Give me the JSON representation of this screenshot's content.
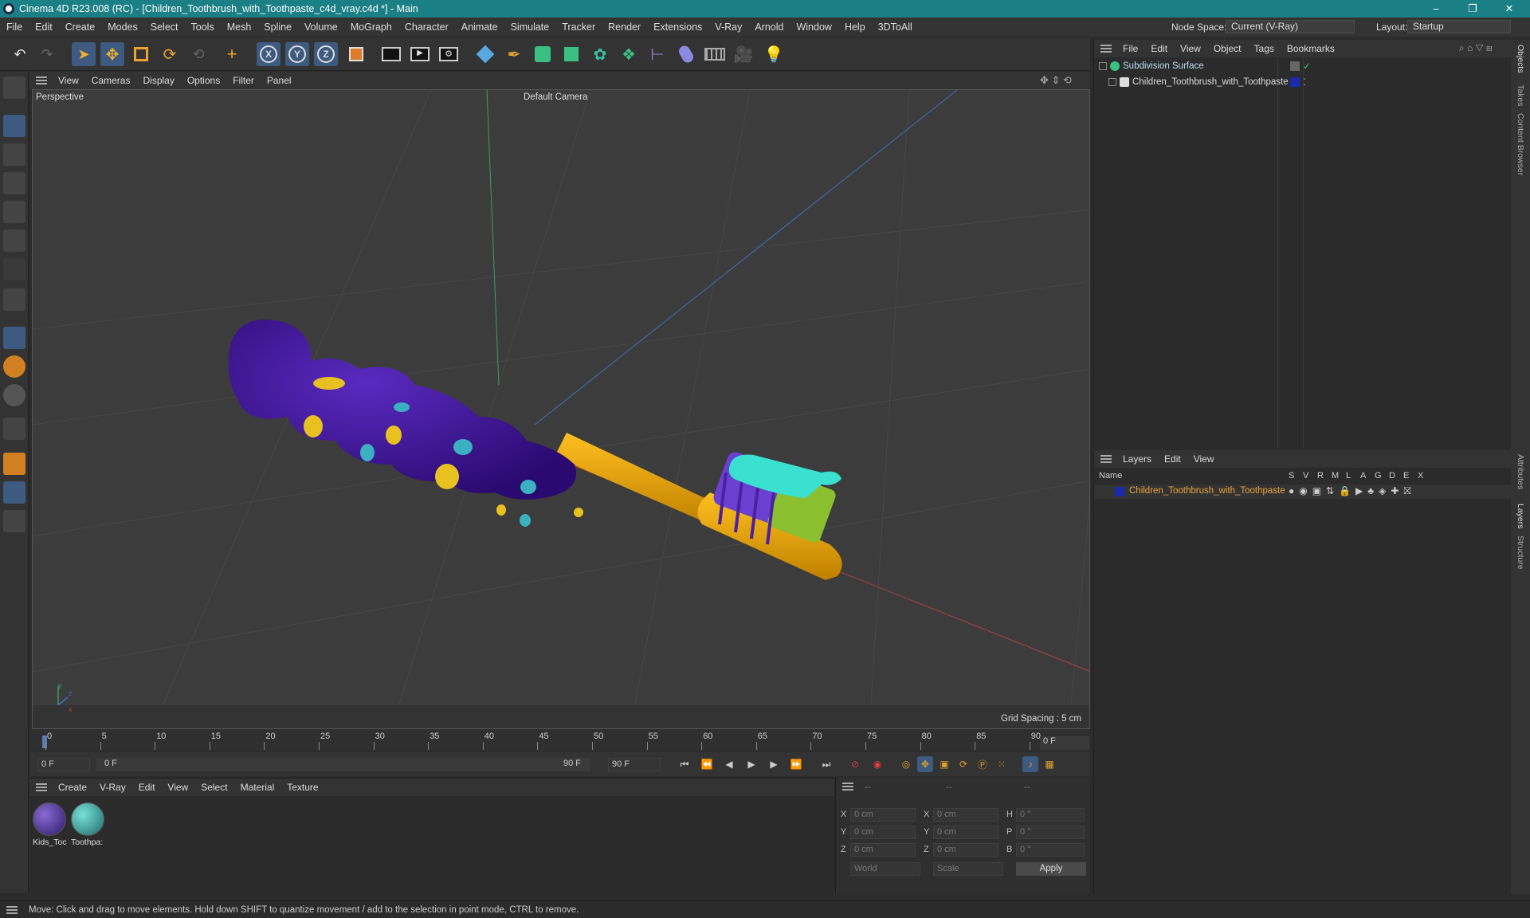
{
  "window": {
    "title": "Cinema 4D R23.008 (RC) - [Children_Toothbrush_with_Toothpaste_c4d_vray.c4d *] - Main",
    "minimize": "–",
    "restore": "❐",
    "close": "✕"
  },
  "menu": [
    "File",
    "Edit",
    "Create",
    "Modes",
    "Select",
    "Tools",
    "Mesh",
    "Spline",
    "Volume",
    "MoGraph",
    "Character",
    "Animate",
    "Simulate",
    "Tracker",
    "Render",
    "Extensions",
    "V-Ray",
    "Arnold",
    "Window",
    "Help",
    "3DToAll"
  ],
  "node_space": {
    "label": "Node Space:",
    "value": "Current (V-Ray)"
  },
  "layout": {
    "label": "Layout:",
    "value": "Startup"
  },
  "toolbar_icons": [
    "undo-icon",
    "redo-icon",
    "select-icon",
    "move-icon",
    "scale-icon",
    "rotate-icon",
    "recent-icon",
    "add-icon",
    "x-axis-icon",
    "y-axis-icon",
    "z-axis-icon",
    "coordinate-system-icon",
    "render-view-icon",
    "render-picture-viewer-icon",
    "render-settings-icon",
    "cube-icon",
    "pen-icon",
    "subdivision-icon",
    "extrude-icon",
    "cloner-icon",
    "mograph-icon",
    "symmetry-icon",
    "deformer-icon",
    "floor-icon",
    "camera-icon",
    "light-icon"
  ],
  "viewport": {
    "menu": [
      "View",
      "Cameras",
      "Display",
      "Options",
      "Filter",
      "Panel"
    ],
    "label": "Perspective",
    "camera": "Default Camera",
    "grid_spacing": "Grid Spacing : 5 cm",
    "axis_labels": {
      "y": "y",
      "z": "z",
      "x": "x"
    }
  },
  "timeline": {
    "ticks": [
      "0",
      "5",
      "10",
      "15",
      "20",
      "25",
      "30",
      "35",
      "40",
      "45",
      "50",
      "55",
      "60",
      "65",
      "70",
      "75",
      "80",
      "85",
      "90"
    ],
    "current_frame": "0 F"
  },
  "playbar": {
    "start": "0 F",
    "range_start": "0 F",
    "range_end": "90 F",
    "end": "90 F"
  },
  "material_manager": {
    "menu": [
      "Create",
      "V-Ray",
      "Edit",
      "View",
      "Select",
      "Material",
      "Texture"
    ],
    "materials": [
      {
        "name": "Kids_Toc",
        "color": "#4a3a8a"
      },
      {
        "name": "Toothpa:",
        "color": "#2a9a9a"
      }
    ]
  },
  "coordinates": {
    "headers": [
      "--",
      "--",
      "--"
    ],
    "rows": [
      {
        "a": "X",
        "pos": "0 cm",
        "b": "X",
        "size": "0 cm",
        "c": "H",
        "rot": "0 °"
      },
      {
        "a": "Y",
        "pos": "0 cm",
        "b": "Y",
        "size": "0 cm",
        "c": "P",
        "rot": "0 °"
      },
      {
        "a": "Z",
        "pos": "0 cm",
        "b": "Z",
        "size": "0 cm",
        "c": "B",
        "rot": "0 °"
      }
    ],
    "mode": "World",
    "scale": "Scale",
    "apply": "Apply"
  },
  "objects": {
    "menu": [
      "File",
      "Edit",
      "View",
      "Object",
      "Tags",
      "Bookmarks"
    ],
    "items": [
      {
        "name": "Subdivision Surface",
        "color": "#bde"
      },
      {
        "name": "Children_Toothbrush_with_Toothpaste",
        "color": "#ddd"
      }
    ]
  },
  "layers": {
    "menu": [
      "Layers",
      "Edit",
      "View"
    ],
    "columns": [
      "Name",
      "S",
      "V",
      "R",
      "M",
      "L",
      "A",
      "G",
      "D",
      "E",
      "X"
    ],
    "items": [
      {
        "name": "Children_Toothbrush_with_Toothpaste",
        "color": "#e8a23a"
      }
    ]
  },
  "right_tabs": [
    "Objects",
    "Takes",
    "Content Browser",
    "Attributes",
    "Layers",
    "Structure"
  ],
  "status": "Move: Click and drag to move elements. Hold down SHIFT to quantize movement / add to the selection in point mode, CTRL to remove."
}
